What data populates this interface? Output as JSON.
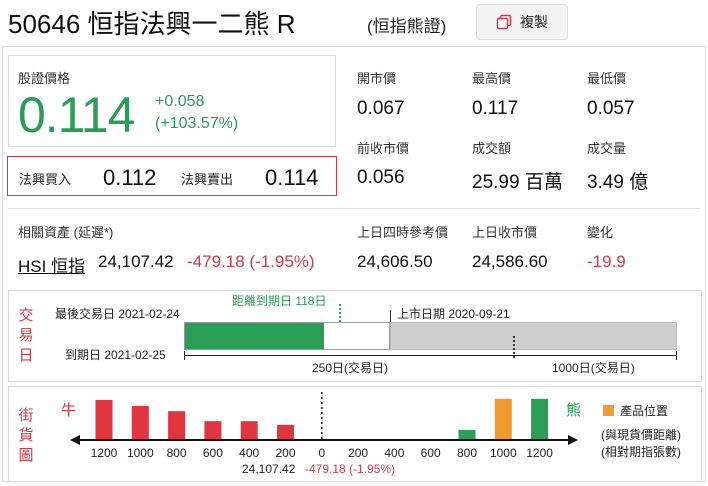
{
  "header": {
    "title": "50646 恒指法興一二熊 R",
    "subtitle": "(恒指熊證)",
    "copy_label": "複製"
  },
  "price": {
    "label": "股證價格",
    "value": "0.114",
    "change": "+0.058",
    "change_pct": "(+103.57%)",
    "color_up": "#2a9d56"
  },
  "bid_ask": {
    "bid_label": "法興買入",
    "bid_value": "0.112",
    "ask_label": "法興賣出",
    "ask_value": "0.114",
    "border_color": "#cf3a46"
  },
  "stats": [
    {
      "label": "開市價",
      "value": "0.067"
    },
    {
      "label": "最高價",
      "value": "0.117"
    },
    {
      "label": "最低價",
      "value": "0.057"
    },
    {
      "label": "前收市價",
      "value": "0.056"
    },
    {
      "label": "成交額",
      "value": "25.99 百萬"
    },
    {
      "label": "成交量",
      "value": "3.49 億"
    }
  ],
  "underlying": {
    "label": "相關資產 (延遲*)",
    "name": "HSI 恒指",
    "price": "24,107.42",
    "change": "-479.18 (-1.95%)",
    "ref_label": "上日四時參考價",
    "ref_value": "24,606.50",
    "close_label": "上日收市價",
    "close_value": "24,586.60",
    "diff_label": "變化",
    "diff_value": "-19.9",
    "color_down": "#cf3a46"
  },
  "trade_days": {
    "side_label": [
      "交",
      "易",
      "日"
    ],
    "last_trade": "最後交易日 2021-02-24",
    "remaining": "距離到期日 118日",
    "listing": "上市日期 2020-09-21",
    "expiry": "到期日 2021-02-25",
    "scale_250": "250日(交易日)",
    "scale_1000": "1000日(交易日)",
    "remaining_fraction": 0.68
  },
  "street": {
    "side_label": [
      "街",
      "貨",
      "圖"
    ],
    "bull_label": "牛",
    "bear_label": "熊",
    "legend_label": "產品位置",
    "note1": "(與現貨價距離)",
    "note2": "(相對期指張數)",
    "underlying_line": "24,107.42",
    "underlying_change": "-479.18 (-1.95%)",
    "ticks": [
      "1200",
      "1000",
      "800",
      "600",
      "400",
      "200",
      "0",
      "200",
      "400",
      "600",
      "800",
      "1000",
      "1200"
    ],
    "bull_color": "#e0363f",
    "bear_color": "#2a9d56",
    "product_color": "#f29a2e"
  },
  "chart_data": {
    "type": "bar",
    "categories": [
      "1200",
      "1000",
      "800",
      "600",
      "400",
      "200",
      "0",
      "200",
      "400",
      "600",
      "800",
      "1000",
      "1200"
    ],
    "series": [
      {
        "name": "牛",
        "values": [
          1.0,
          0.85,
          0.72,
          0.47,
          0.47,
          0.38,
          0,
          0,
          0,
          0,
          0,
          0,
          0
        ]
      },
      {
        "name": "熊",
        "values": [
          0,
          0,
          0,
          0,
          0,
          0,
          0,
          0,
          0,
          0,
          0.25,
          1.03,
          1.03
        ]
      }
    ],
    "highlight_index": 11
  }
}
